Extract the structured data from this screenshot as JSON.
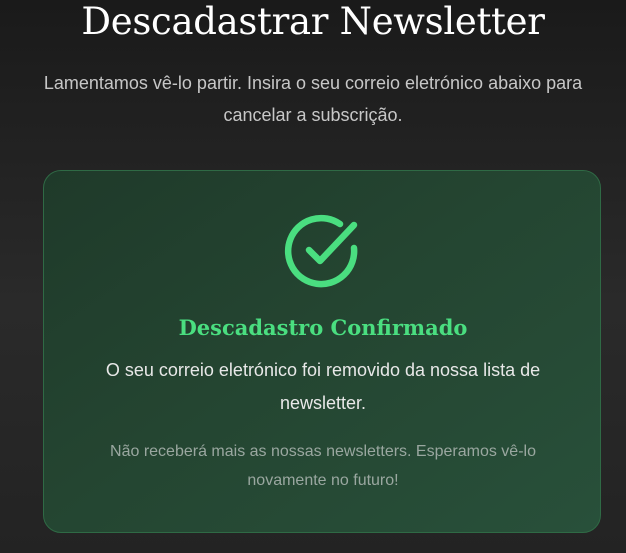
{
  "page": {
    "title": "Descadastrar Newsletter",
    "subtitle": "Lamentamos vê-lo partir. Insira o seu correio eletrónico abaixo para cancelar a subscrição."
  },
  "confirmation": {
    "icon": "check-circle-icon",
    "title": "Descadastro Confirmado",
    "message": "O seu correio eletrónico foi removido da nossa lista de newsletter.",
    "note": "Não receberá mais as nossas newsletters. Esperamos vê-lo novamente no futuro!"
  },
  "colors": {
    "accent": "#4ade80",
    "card_border": "#2f6a45",
    "background": "#222222"
  }
}
